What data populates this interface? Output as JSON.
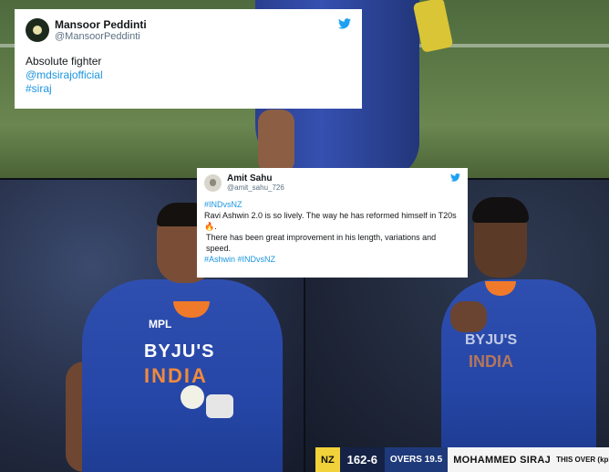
{
  "tweet_top": {
    "name": "Mansoor Peddinti",
    "handle": "@MansoorPeddinti",
    "text": "Absolute fighter",
    "mention": "@mdsirajofficial",
    "hashtag": "#siraj"
  },
  "tweet_middle": {
    "name": "Amit Sahu",
    "handle": "@amit_sahu_726",
    "hashtag_top": "#INDvsNZ",
    "line1": "Ravi Ashwin 2.0 is so lively. The way he has reformed himself in T20s 🔥.",
    "line2": "There has been great improvement in his length, variations and speed.",
    "hashtags_bottom": "#Ashwin #INDvsNZ"
  },
  "jersey_left": {
    "sponsor": "MPL",
    "brand": "BYJU'S",
    "country": "INDIA"
  },
  "jersey_right": {
    "brand": "BYJU'S",
    "country": "INDIA"
  },
  "scorebar": {
    "team": "NZ",
    "score": "162-6",
    "overs": "OVERS 19.5",
    "bowler": "MOHAMMED SIRAJ",
    "this_over": "THIS OVER (kph)"
  },
  "colors": {
    "twitter_blue": "#1da1f2",
    "link_blue": "#1b95e0",
    "jersey_blue": "#2546a6",
    "jersey_orange": "#f07a2a",
    "score_yellow": "#f2d23a"
  }
}
